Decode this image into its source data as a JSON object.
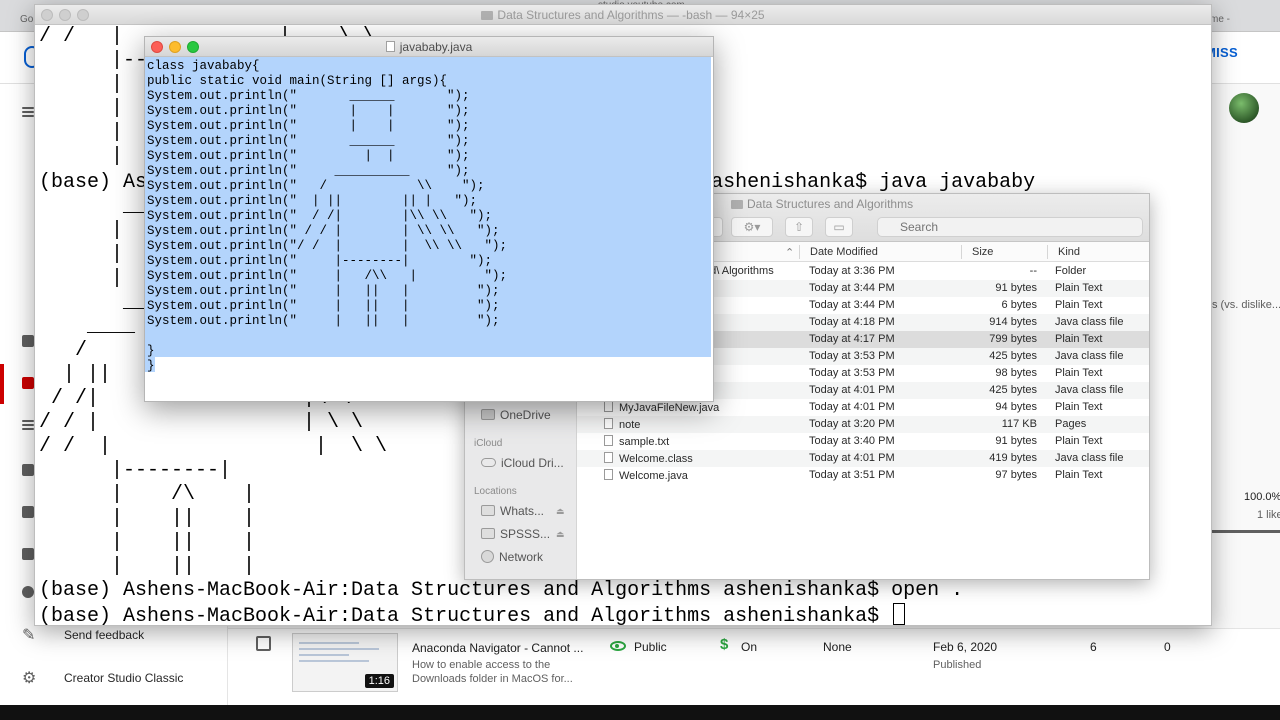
{
  "browser": {
    "tab_left": "Go",
    "tab_center": "studio.youtube.com",
    "tab_right": "me -",
    "dismiss_label": "SMISS",
    "sidebar": {
      "send_feedback": "Send feedback",
      "creator_studio_classic": "Creator Studio Classic"
    },
    "right_panel": {
      "likes_caption": "s (vs. dislike...",
      "percent": "100.0%",
      "likes": "1 like"
    },
    "video_row": {
      "title": "Anaconda Navigator - Cannot ...",
      "description_1": "How to enable access to the",
      "description_2": "Downloads folder in MacOS for...",
      "duration": "1:16",
      "visibility": "Public",
      "monetization": "On",
      "restrictions": "None",
      "date": "Feb 6, 2020",
      "date_status": "Published",
      "views": "6",
      "comments": "0"
    },
    "colors": {
      "accent": "#065fd4",
      "public_green": "#2ba640",
      "active_red": "#cc0000"
    }
  },
  "terminal": {
    "title": "Data Structures and Algorithms — -bash — 94×25",
    "lines": [
      "/ /   |             |    \\ \\",
      "      |---",
      "      |",
      "      |",
      "      |",
      "      |",
      "(base) As                                            ms ashenishanka$ java javababy",
      "       __",
      "      |",
      "      |",
      "      |",
      "       __",
      "",
      "    ____",
      "   /",
      "  | ||",
      " / /|                 |\\ \\",
      "/ / |                 | \\ \\",
      "/ /  |                 |  \\ \\",
      "      |--------|",
      "      |    /\\    |",
      "      |    ||    |",
      "      |    ||    |",
      "      |    ||    |",
      "(base) Ashens-MacBook-Air:Data Structures and Algorithms ashenishanka$ open .",
      "(base) Ashens-MacBook-Air:Data Structures and Algorithms ashenishanka$ "
    ]
  },
  "finder": {
    "title": "Data Structures and Algorithms",
    "search_placeholder": "Search",
    "sidebar": {
      "onedrive": "OneDrive",
      "icloud_header": "iCloud",
      "icloud_drive": "iCloud Dri...",
      "locations_header": "Locations",
      "whats": "Whats...",
      "spss": "SPSSS...",
      "network": "Network"
    },
    "columns": {
      "date": "Date Modified",
      "size": "Size",
      "kind": "Kind"
    },
    "rows": [
      {
        "name": "nd\\ Algorithms",
        "date": "Today at 3:36 PM",
        "size": "--",
        "kind": "Folder"
      },
      {
        "name": "",
        "date": "Today at 3:44 PM",
        "size": "91 bytes",
        "kind": "Plain Text"
      },
      {
        "name": "",
        "date": "Today at 3:44 PM",
        "size": "6 bytes",
        "kind": "Plain Text"
      },
      {
        "name": "",
        "date": "Today at 4:18 PM",
        "size": "914 bytes",
        "kind": "Java class file"
      },
      {
        "name": "",
        "date": "Today at 4:17 PM",
        "size": "799 bytes",
        "kind": "Plain Text"
      },
      {
        "name": "",
        "date": "Today at 3:53 PM",
        "size": "425 bytes",
        "kind": "Java class file"
      },
      {
        "name": "",
        "date": "Today at 3:53 PM",
        "size": "98 bytes",
        "kind": "Plain Text"
      },
      {
        "name": "ss",
        "date": "Today at 4:01 PM",
        "size": "425 bytes",
        "kind": "Java class file"
      },
      {
        "name": "MyJavaFileNew.java",
        "date": "Today at 4:01 PM",
        "size": "94 bytes",
        "kind": "Plain Text"
      },
      {
        "name": "note",
        "date": "Today at 3:20 PM",
        "size": "117 KB",
        "kind": "Pages"
      },
      {
        "name": "sample.txt",
        "date": "Today at 3:40 PM",
        "size": "91 bytes",
        "kind": "Plain Text"
      },
      {
        "name": "Welcome.class",
        "date": "Today at 4:01 PM",
        "size": "419 bytes",
        "kind": "Java class file"
      },
      {
        "name": "Welcome.java",
        "date": "Today at 3:51 PM",
        "size": "97 bytes",
        "kind": "Plain Text"
      }
    ]
  },
  "editor": {
    "title": "javababy.java",
    "code": [
      "class javababy{",
      "public static void main(String [] args){",
      "System.out.println(\"       ______       \");",
      "System.out.println(\"       |    |       \");",
      "System.out.println(\"       |    |       \");",
      "System.out.println(\"       ______       \");",
      "System.out.println(\"         |  |       \");",
      "System.out.println(\"     __________     \");",
      "System.out.println(\"   /            \\\\    \");",
      "System.out.println(\"  | ||        || |   \");",
      "System.out.println(\"  / /|        |\\\\ \\\\   \");",
      "System.out.println(\" / / |        | \\\\ \\\\   \");",
      "System.out.println(\"/ /  |        |  \\\\ \\\\   \");",
      "System.out.println(\"     |--------|        \");",
      "System.out.println(\"     |   /\\\\   |         \");",
      "System.out.println(\"     |   ||   |         \");",
      "System.out.println(\"     |   ||   |         \");",
      "System.out.println(\"     |   ||   |         \");",
      "",
      "}",
      "}"
    ],
    "selection_color": "#b3d4fc"
  }
}
